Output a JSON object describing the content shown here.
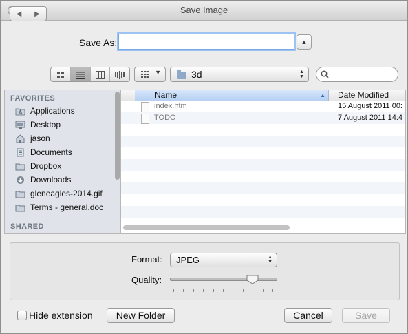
{
  "window": {
    "title": "Save Image"
  },
  "save_as": {
    "label": "Save As:",
    "value": ""
  },
  "toolbar": {
    "location": "3d",
    "view_modes": [
      "icon-view-icon",
      "list-view-icon",
      "column-view-icon",
      "coverflow-view-icon"
    ],
    "active_view": "list-view-icon"
  },
  "sidebar": {
    "favorites_heading": "FAVORITES",
    "items": [
      {
        "label": "Applications",
        "icon": "applications-icon"
      },
      {
        "label": "Desktop",
        "icon": "desktop-icon"
      },
      {
        "label": "jason",
        "icon": "home-icon"
      },
      {
        "label": "Documents",
        "icon": "documents-icon"
      },
      {
        "label": "Dropbox",
        "icon": "folder-icon"
      },
      {
        "label": "Downloads",
        "icon": "downloads-icon"
      },
      {
        "label": "gleneagles-2014.gif",
        "icon": "folder-icon"
      },
      {
        "label": "Terms - general.doc",
        "icon": "folder-icon"
      }
    ],
    "shared_heading": "SHARED"
  },
  "file_list": {
    "columns": {
      "name": "Name",
      "date_modified": "Date Modified"
    },
    "rows": [
      {
        "name": "index.htm",
        "date": "15 August 2011 00:"
      },
      {
        "name": "TODO",
        "date": "7 August 2011 14:4"
      }
    ]
  },
  "accessory": {
    "format_label": "Format:",
    "format_value": "JPEG",
    "quality_label": "Quality:",
    "quality_fraction": 0.78
  },
  "bottom": {
    "hide_extension_label": "Hide extension",
    "new_folder_label": "New Folder",
    "cancel_label": "Cancel",
    "save_label": "Save"
  }
}
